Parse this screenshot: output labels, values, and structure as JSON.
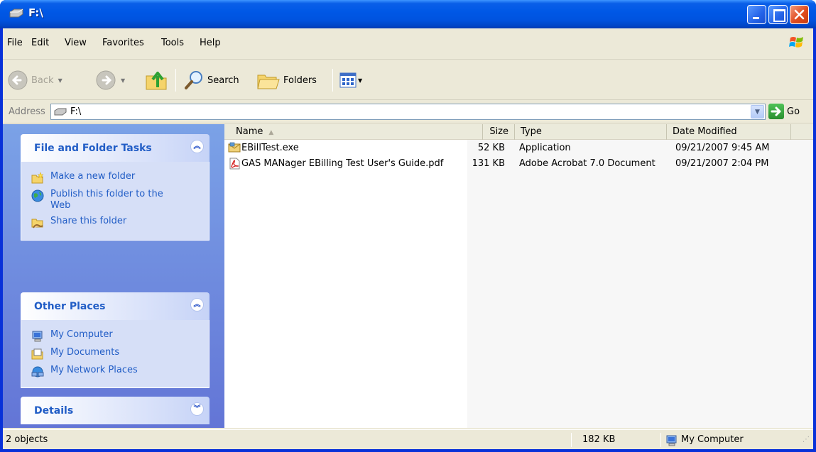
{
  "window": {
    "title": "F:\\"
  },
  "menu": {
    "file": "File",
    "edit": "Edit",
    "view": "View",
    "favorites": "Favorites",
    "tools": "Tools",
    "help": "Help"
  },
  "toolbar": {
    "back": "Back",
    "search": "Search",
    "folders": "Folders"
  },
  "address": {
    "label": "Address",
    "value": "F:\\",
    "go": "Go"
  },
  "tasks": {
    "file_folder": {
      "title": "File and Folder Tasks",
      "items": [
        {
          "label": "Make a new folder",
          "icon": "new-folder-icon"
        },
        {
          "label": "Publish this folder to the Web",
          "icon": "publish-web-icon"
        },
        {
          "label": "Share this folder",
          "icon": "share-folder-icon"
        }
      ]
    },
    "other_places": {
      "title": "Other Places",
      "items": [
        {
          "label": "My Computer",
          "icon": "my-computer-icon"
        },
        {
          "label": "My Documents",
          "icon": "my-documents-icon"
        },
        {
          "label": "My Network Places",
          "icon": "network-places-icon"
        }
      ]
    },
    "details": {
      "title": "Details"
    }
  },
  "columns": {
    "name": "Name",
    "size": "Size",
    "type": "Type",
    "date": "Date Modified"
  },
  "files": [
    {
      "name": "EBillTest.exe",
      "size": "52 KB",
      "type": "Application",
      "date": "09/21/2007 9:45 AM",
      "icon": "exe-icon"
    },
    {
      "name": "GAS MANager EBilling Test User's Guide.pdf",
      "size": "131 KB",
      "type": "Adobe Acrobat 7.0 Document",
      "date": "09/21/2007 2:04 PM",
      "icon": "pdf-icon"
    }
  ],
  "status": {
    "objects": "2 objects",
    "size": "182 KB",
    "location": "My Computer"
  },
  "colors": {
    "title_blue": "#0054e3",
    "task_link": "#215dc6",
    "task_bg": "#6f8fe0"
  }
}
